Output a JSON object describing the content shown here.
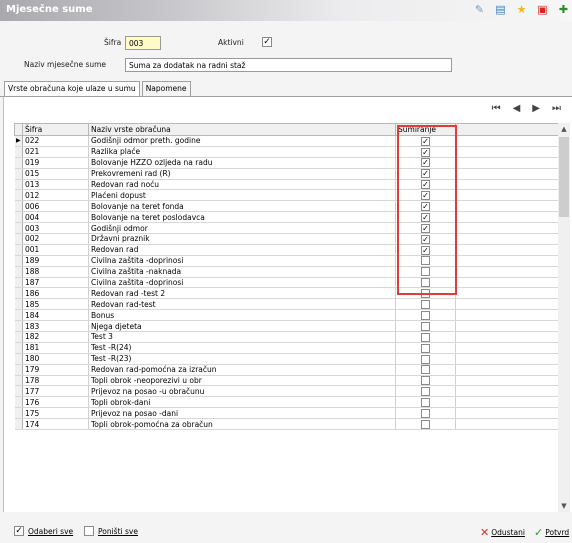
{
  "window": {
    "title": "Mjesečne sume"
  },
  "toolbar": {
    "icons": [
      "edit-icon",
      "table-icon",
      "star-icon",
      "pdf-icon",
      "exit-icon"
    ]
  },
  "form": {
    "sifra_label": "Šifra",
    "sifra_value": "003",
    "aktivni_label": "Aktivni",
    "aktivni_checked": true,
    "naziv_label": "Naziv mjesečne sume",
    "naziv_value": "Suma za dodatak na radni staž"
  },
  "tabs": [
    {
      "label": "Vrste obračuna koje ulaze u sumu",
      "active": true
    },
    {
      "label": "Napomene",
      "active": false
    }
  ],
  "nav": {
    "first": "⏮",
    "prev": "◀",
    "next": "▶",
    "last": "⏭"
  },
  "grid": {
    "headers": {
      "sifra": "Šifra",
      "naziv": "Naziv vrste obračuna",
      "sumiranje": "Sumiranje"
    },
    "rows": [
      {
        "sifra": "022",
        "naziv": "Godišnji odmor preth. godine",
        "checked": true
      },
      {
        "sifra": "021",
        "naziv": "Razlika plaće",
        "checked": true
      },
      {
        "sifra": "019",
        "naziv": "Bolovanje HZZO ozljeda na radu",
        "checked": true
      },
      {
        "sifra": "015",
        "naziv": "Prekovremeni rad (R)",
        "checked": true
      },
      {
        "sifra": "013",
        "naziv": "Redovan rad noću",
        "checked": true
      },
      {
        "sifra": "012",
        "naziv": "Plaćeni dopust",
        "checked": true
      },
      {
        "sifra": "006",
        "naziv": "Bolovanje na teret fonda",
        "checked": true
      },
      {
        "sifra": "004",
        "naziv": "Bolovanje na teret poslodavca",
        "checked": true
      },
      {
        "sifra": "003",
        "naziv": "Godišnji odmor",
        "checked": true
      },
      {
        "sifra": "002",
        "naziv": "Državni praznik",
        "checked": true
      },
      {
        "sifra": "001",
        "naziv": "Redovan rad",
        "checked": true
      },
      {
        "sifra": "189",
        "naziv": "Civilna zaštita -doprinosi",
        "checked": false
      },
      {
        "sifra": "188",
        "naziv": "Civilna zaštita -naknada",
        "checked": false
      },
      {
        "sifra": "187",
        "naziv": "Civilna zaštita -doprinosi",
        "checked": false
      },
      {
        "sifra": "186",
        "naziv": "Redovan rad -test 2",
        "checked": false
      },
      {
        "sifra": "185",
        "naziv": "Redovan rad-test",
        "checked": false
      },
      {
        "sifra": "184",
        "naziv": "Bonus",
        "checked": false
      },
      {
        "sifra": "183",
        "naziv": "Njega djeteta",
        "checked": false
      },
      {
        "sifra": "182",
        "naziv": "Test 3",
        "checked": false
      },
      {
        "sifra": "181",
        "naziv": "Test -R(24)",
        "checked": false
      },
      {
        "sifra": "180",
        "naziv": "Test -R(23)",
        "checked": false
      },
      {
        "sifra": "179",
        "naziv": "Redovan rad-pomoćna za izračun",
        "checked": false
      },
      {
        "sifra": "178",
        "naziv": "Topli obrok -neoporezivi u obr",
        "checked": false
      },
      {
        "sifra": "177",
        "naziv": "Prijevoz na posao -u obračunu",
        "checked": false
      },
      {
        "sifra": "176",
        "naziv": "Topli obrok-dani",
        "checked": false
      },
      {
        "sifra": "175",
        "naziv": "Prijevoz na posao -dani",
        "checked": false
      },
      {
        "sifra": "174",
        "naziv": "Topli obrok-pomoćna za obračun",
        "checked": false
      }
    ]
  },
  "bottom": {
    "odaberi_sve": "Odaberi sve",
    "odaberi_checked": true,
    "ponisti_sve": "Poništi sve",
    "ponisti_checked": false,
    "odustani": "Odustani",
    "potvrdi": "Potvrd"
  },
  "colors": {
    "highlight": "#e03c3c",
    "cancel": "#d9322b",
    "confirm": "#2e9a2e"
  }
}
